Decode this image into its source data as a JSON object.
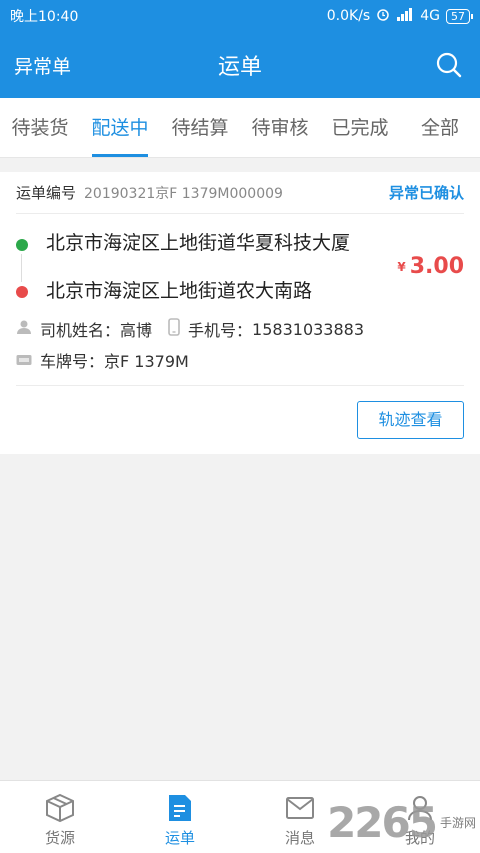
{
  "status_bar": {
    "time": "晚上10:40",
    "speed": "0.0K/s",
    "network": "4G",
    "battery": "57"
  },
  "app_bar": {
    "left_label": "异常单",
    "title": "运单"
  },
  "tabs": [
    {
      "label": "待装货"
    },
    {
      "label": "配送中"
    },
    {
      "label": "待结算"
    },
    {
      "label": "待审核"
    },
    {
      "label": "已完成"
    },
    {
      "label": "全部"
    }
  ],
  "active_tab": "配送中",
  "order": {
    "number_label": "运单编号",
    "number": "20190321京F 1379M000009",
    "status": "异常已确认",
    "from": "北京市海淀区上地街道华夏科技大厦",
    "to": "北京市海淀区上地街道农大南路",
    "currency": "¥",
    "price": "3.00",
    "driver_label": "司机姓名：",
    "driver_name": "高博",
    "phone_label": "手机号：",
    "phone": "15831033883",
    "plate_label": "车牌号：",
    "plate": "京F 1379M",
    "track_button": "轨迹查看"
  },
  "bottom_nav": [
    {
      "label": "货源",
      "icon": "box-icon"
    },
    {
      "label": "运单",
      "icon": "document-icon"
    },
    {
      "label": "消息",
      "icon": "mail-icon"
    },
    {
      "label": "我的",
      "icon": "user-icon"
    }
  ],
  "watermark": {
    "text": "2265",
    "sub": "手游网"
  },
  "colors": {
    "primary": "#1e8fe1",
    "price": "#e84b4b",
    "origin_dot": "#2ca84a",
    "dest_dot": "#e84b4b"
  }
}
